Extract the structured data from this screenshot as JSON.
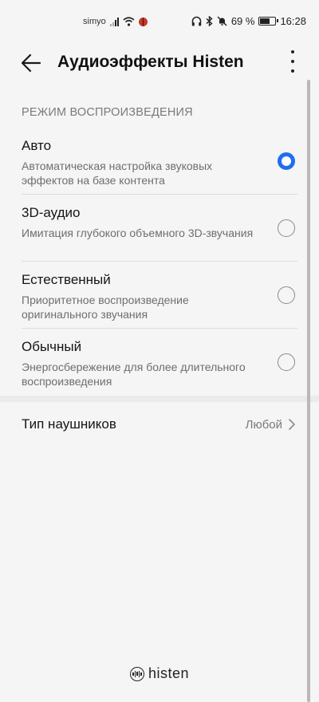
{
  "status_bar": {
    "carrier": "simyo",
    "battery_percent": "69 %",
    "battery_level": 0.69,
    "time": "16:28"
  },
  "header": {
    "title": "Аудиоэффекты Histen"
  },
  "playback_mode": {
    "section_title": "РЕЖИМ ВОСПРОИЗВЕДЕНИЯ",
    "options": [
      {
        "title": "Авто",
        "description": "Автоматическая настройка звуковых эффектов на базе контента",
        "selected": true
      },
      {
        "title": "3D-аудио",
        "description": "Имитация глубокого объемного 3D-звучания",
        "selected": false
      },
      {
        "title": "Естественный",
        "description": "Приоритетное воспроизведение оригинального звучания",
        "selected": false
      },
      {
        "title": "Обычный",
        "description": "Энергосбережение для более длительного воспроизведения",
        "selected": false
      }
    ]
  },
  "headphones": {
    "label": "Тип наушников",
    "value": "Любой"
  },
  "footer": {
    "logo_text": "histen"
  },
  "colors": {
    "accent": "#1f6ef0",
    "background": "#f5f5f5"
  }
}
